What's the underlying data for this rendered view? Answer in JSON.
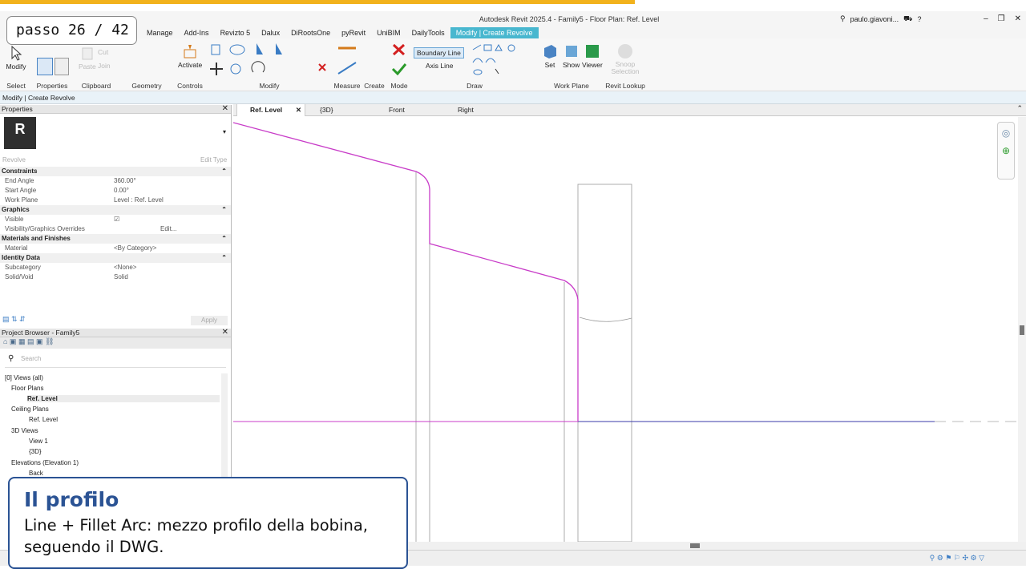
{
  "step": {
    "label": "passo 26 / 42"
  },
  "titlebar": {
    "title": "Autodesk Revit 2025.4 - Family5 - Floor Plan: Ref. Level",
    "user": "paulo.giavoni..."
  },
  "ribbon_tabs": [
    "Manage",
    "Add-Ins",
    "Revizto 5",
    "Dalux",
    "DiRootsOne",
    "pyRevit",
    "UniBIM",
    "DailyTools",
    "Modify | Create Revolve"
  ],
  "ribbon": {
    "modify": "Modify",
    "activate": "Activate",
    "boundary_line": "Boundary Line",
    "axis_line": "Axis Line",
    "set": "Set",
    "show": "Show",
    "viewer": "Viewer",
    "snoop_selection": "Snoop Selection",
    "cut": "Cut",
    "join": "Join",
    "paste": "Paste",
    "groups": [
      "Select",
      "Properties",
      "Clipboard",
      "Geometry",
      "Controls",
      "Modify",
      "Measure",
      "Create",
      "Mode",
      "Draw",
      "Work Plane",
      "Revit Lookup"
    ]
  },
  "options_bar": "Modify | Create Revolve",
  "properties": {
    "title": "Properties",
    "type_name": "Revolve",
    "edit_type": "Edit Type",
    "apply": "Apply",
    "categories": [
      {
        "name": "Constraints",
        "rows": [
          [
            "End Angle",
            "360.00°"
          ],
          [
            "Start Angle",
            "0.00°"
          ],
          [
            "Work Plane",
            "Level : Ref. Level"
          ]
        ]
      },
      {
        "name": "Graphics",
        "rows": [
          [
            "Visible",
            ""
          ],
          [
            "Visibility/Graphics Overrides",
            "Edit..."
          ]
        ]
      },
      {
        "name": "Materials and Finishes",
        "rows": [
          [
            "Material",
            "<By Category>"
          ]
        ]
      },
      {
        "name": "Identity Data",
        "rows": [
          [
            "Subcategory",
            "<None>"
          ],
          [
            "Solid/Void",
            "Solid"
          ]
        ]
      }
    ]
  },
  "browser": {
    "title": "Project Browser - Family5",
    "search_placeholder": "Search",
    "nodes": [
      "[0] Views (all)",
      "Floor Plans",
      "Ref. Level",
      "Ceiling Plans",
      "Ref. Level",
      "3D Views",
      "View 1",
      "{3D}",
      "Elevations (Elevation 1)",
      "Back"
    ]
  },
  "view_tabs": [
    "Ref. Level",
    "{3D}",
    "Front",
    "Right"
  ],
  "caption": {
    "title": "Il profilo",
    "body": "Line + Fillet Arc: mezzo profilo della bobina, seguendo il DWG."
  },
  "colors": {
    "accent": "#48b7cf",
    "sketch": "#c83cc8",
    "level": "#3a3aa8",
    "caption_border": "#2b5394",
    "progress": "#f2b21c"
  }
}
